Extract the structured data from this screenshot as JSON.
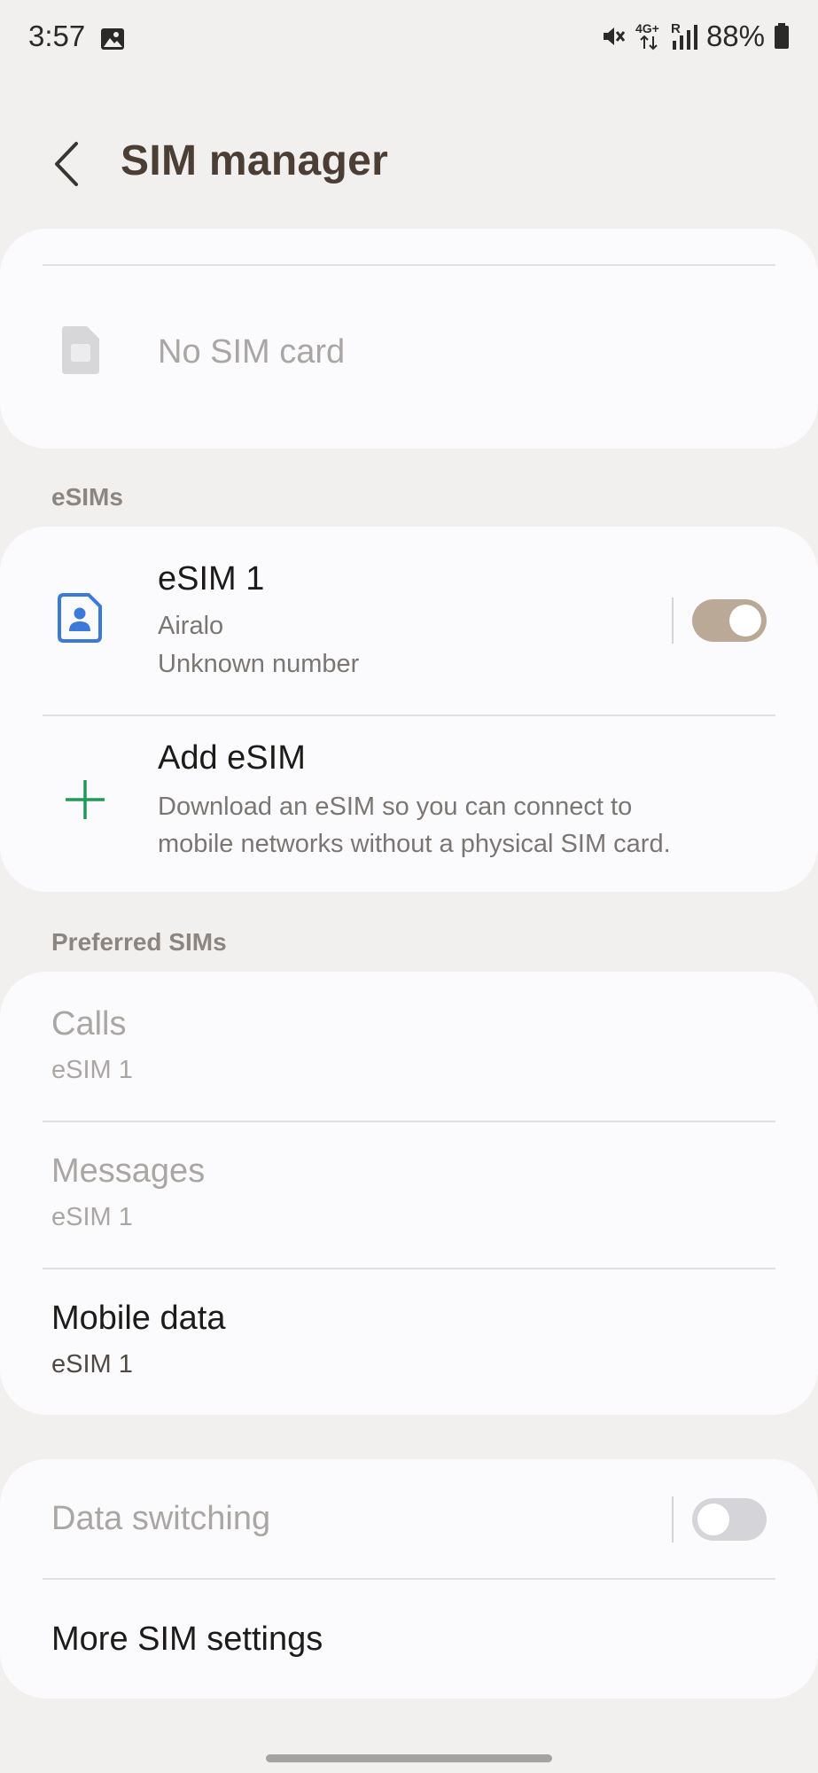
{
  "status_bar": {
    "time": "3:57",
    "network_type": "4G+",
    "roaming": "R",
    "battery": "88%",
    "icons": [
      "gallery-icon",
      "mute-icon",
      "signal-icon",
      "battery-icon"
    ]
  },
  "header": {
    "title": "SIM manager",
    "back_icon": "back-arrow-icon"
  },
  "physical_sim": {
    "label": "No SIM card",
    "icon": "sim-card-icon"
  },
  "esims": {
    "section_label": "eSIMs",
    "items": [
      {
        "title": "eSIM 1",
        "carrier": "Airalo",
        "number": "Unknown number",
        "icon": "esim-icon",
        "enabled": true
      }
    ],
    "add": {
      "title": "Add eSIM",
      "description_line1": "Download an eSIM so you can connect to",
      "description_line2": "mobile networks without a physical SIM card.",
      "icon": "plus-icon"
    }
  },
  "preferred": {
    "section_label": "Preferred SIMs",
    "calls": {
      "title": "Calls",
      "value": "eSIM 1"
    },
    "messages": {
      "title": "Messages",
      "value": "eSIM 1"
    },
    "mobile_data": {
      "title": "Mobile data",
      "value": "eSIM 1"
    }
  },
  "other": {
    "data_switching": {
      "title": "Data switching",
      "enabled": false
    },
    "more_settings": {
      "title": "More SIM settings"
    }
  },
  "colors": {
    "background": "#f1f0ef",
    "card": "#fbfbfd",
    "toggle_on": "#bba998",
    "toggle_off": "#d5d5d9",
    "esim_icon": "#3b7ad9",
    "plus_icon": "#1f9a57",
    "title_text": "#4b3f35"
  }
}
